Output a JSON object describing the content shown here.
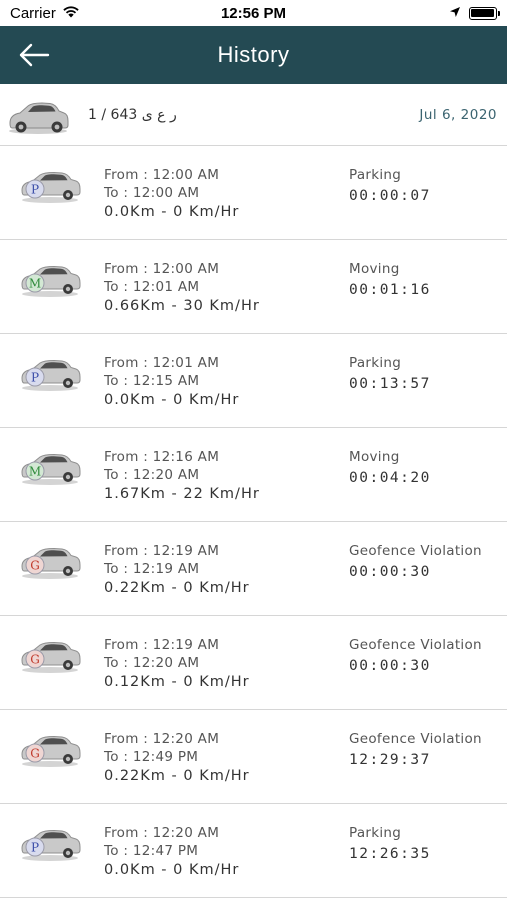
{
  "status_bar": {
    "carrier": "Carrier",
    "time": "12:56 PM"
  },
  "nav": {
    "title": "History"
  },
  "vehicle": {
    "plate": "ر ع ى  643 / 1",
    "date": "Jul 6, 2020"
  },
  "colors": {
    "nav_bg": "#244a53",
    "date": "#3b6470",
    "parking": "#3a4ca8",
    "moving": "#2e8b3a",
    "geofence": "#c0392b"
  },
  "rows": [
    {
      "badge": "P",
      "badge_type": "parking",
      "from": "From : 12:00 AM",
      "to": "To : 12:00 AM",
      "distance": "0.0Km - 0 Km/Hr",
      "status": "Parking",
      "duration": "00:00:07"
    },
    {
      "badge": "M",
      "badge_type": "moving",
      "from": "From : 12:00 AM",
      "to": "To : 12:01 AM",
      "distance": "0.66Km - 30 Km/Hr",
      "status": "Moving",
      "duration": "00:01:16"
    },
    {
      "badge": "P",
      "badge_type": "parking",
      "from": "From : 12:01 AM",
      "to": "To : 12:15 AM",
      "distance": "0.0Km - 0 Km/Hr",
      "status": "Parking",
      "duration": "00:13:57"
    },
    {
      "badge": "M",
      "badge_type": "moving",
      "from": "From : 12:16 AM",
      "to": "To : 12:20 AM",
      "distance": "1.67Km - 22 Km/Hr",
      "status": "Moving",
      "duration": "00:04:20"
    },
    {
      "badge": "G",
      "badge_type": "geofence",
      "from": "From : 12:19 AM",
      "to": "To : 12:19 AM",
      "distance": "0.22Km - 0 Km/Hr",
      "status": "Geofence Violation",
      "duration": "00:00:30"
    },
    {
      "badge": "G",
      "badge_type": "geofence",
      "from": "From : 12:19 AM",
      "to": "To : 12:20 AM",
      "distance": "0.12Km - 0 Km/Hr",
      "status": "Geofence Violation",
      "duration": "00:00:30"
    },
    {
      "badge": "G",
      "badge_type": "geofence",
      "from": "From : 12:20 AM",
      "to": "To : 12:49 PM",
      "distance": "0.22Km - 0 Km/Hr",
      "status": "Geofence Violation",
      "duration": "12:29:37"
    },
    {
      "badge": "P",
      "badge_type": "parking",
      "from": "From : 12:20 AM",
      "to": "To : 12:47 PM",
      "distance": "0.0Km - 0 Km/Hr",
      "status": "Parking",
      "duration": "12:26:35"
    }
  ]
}
